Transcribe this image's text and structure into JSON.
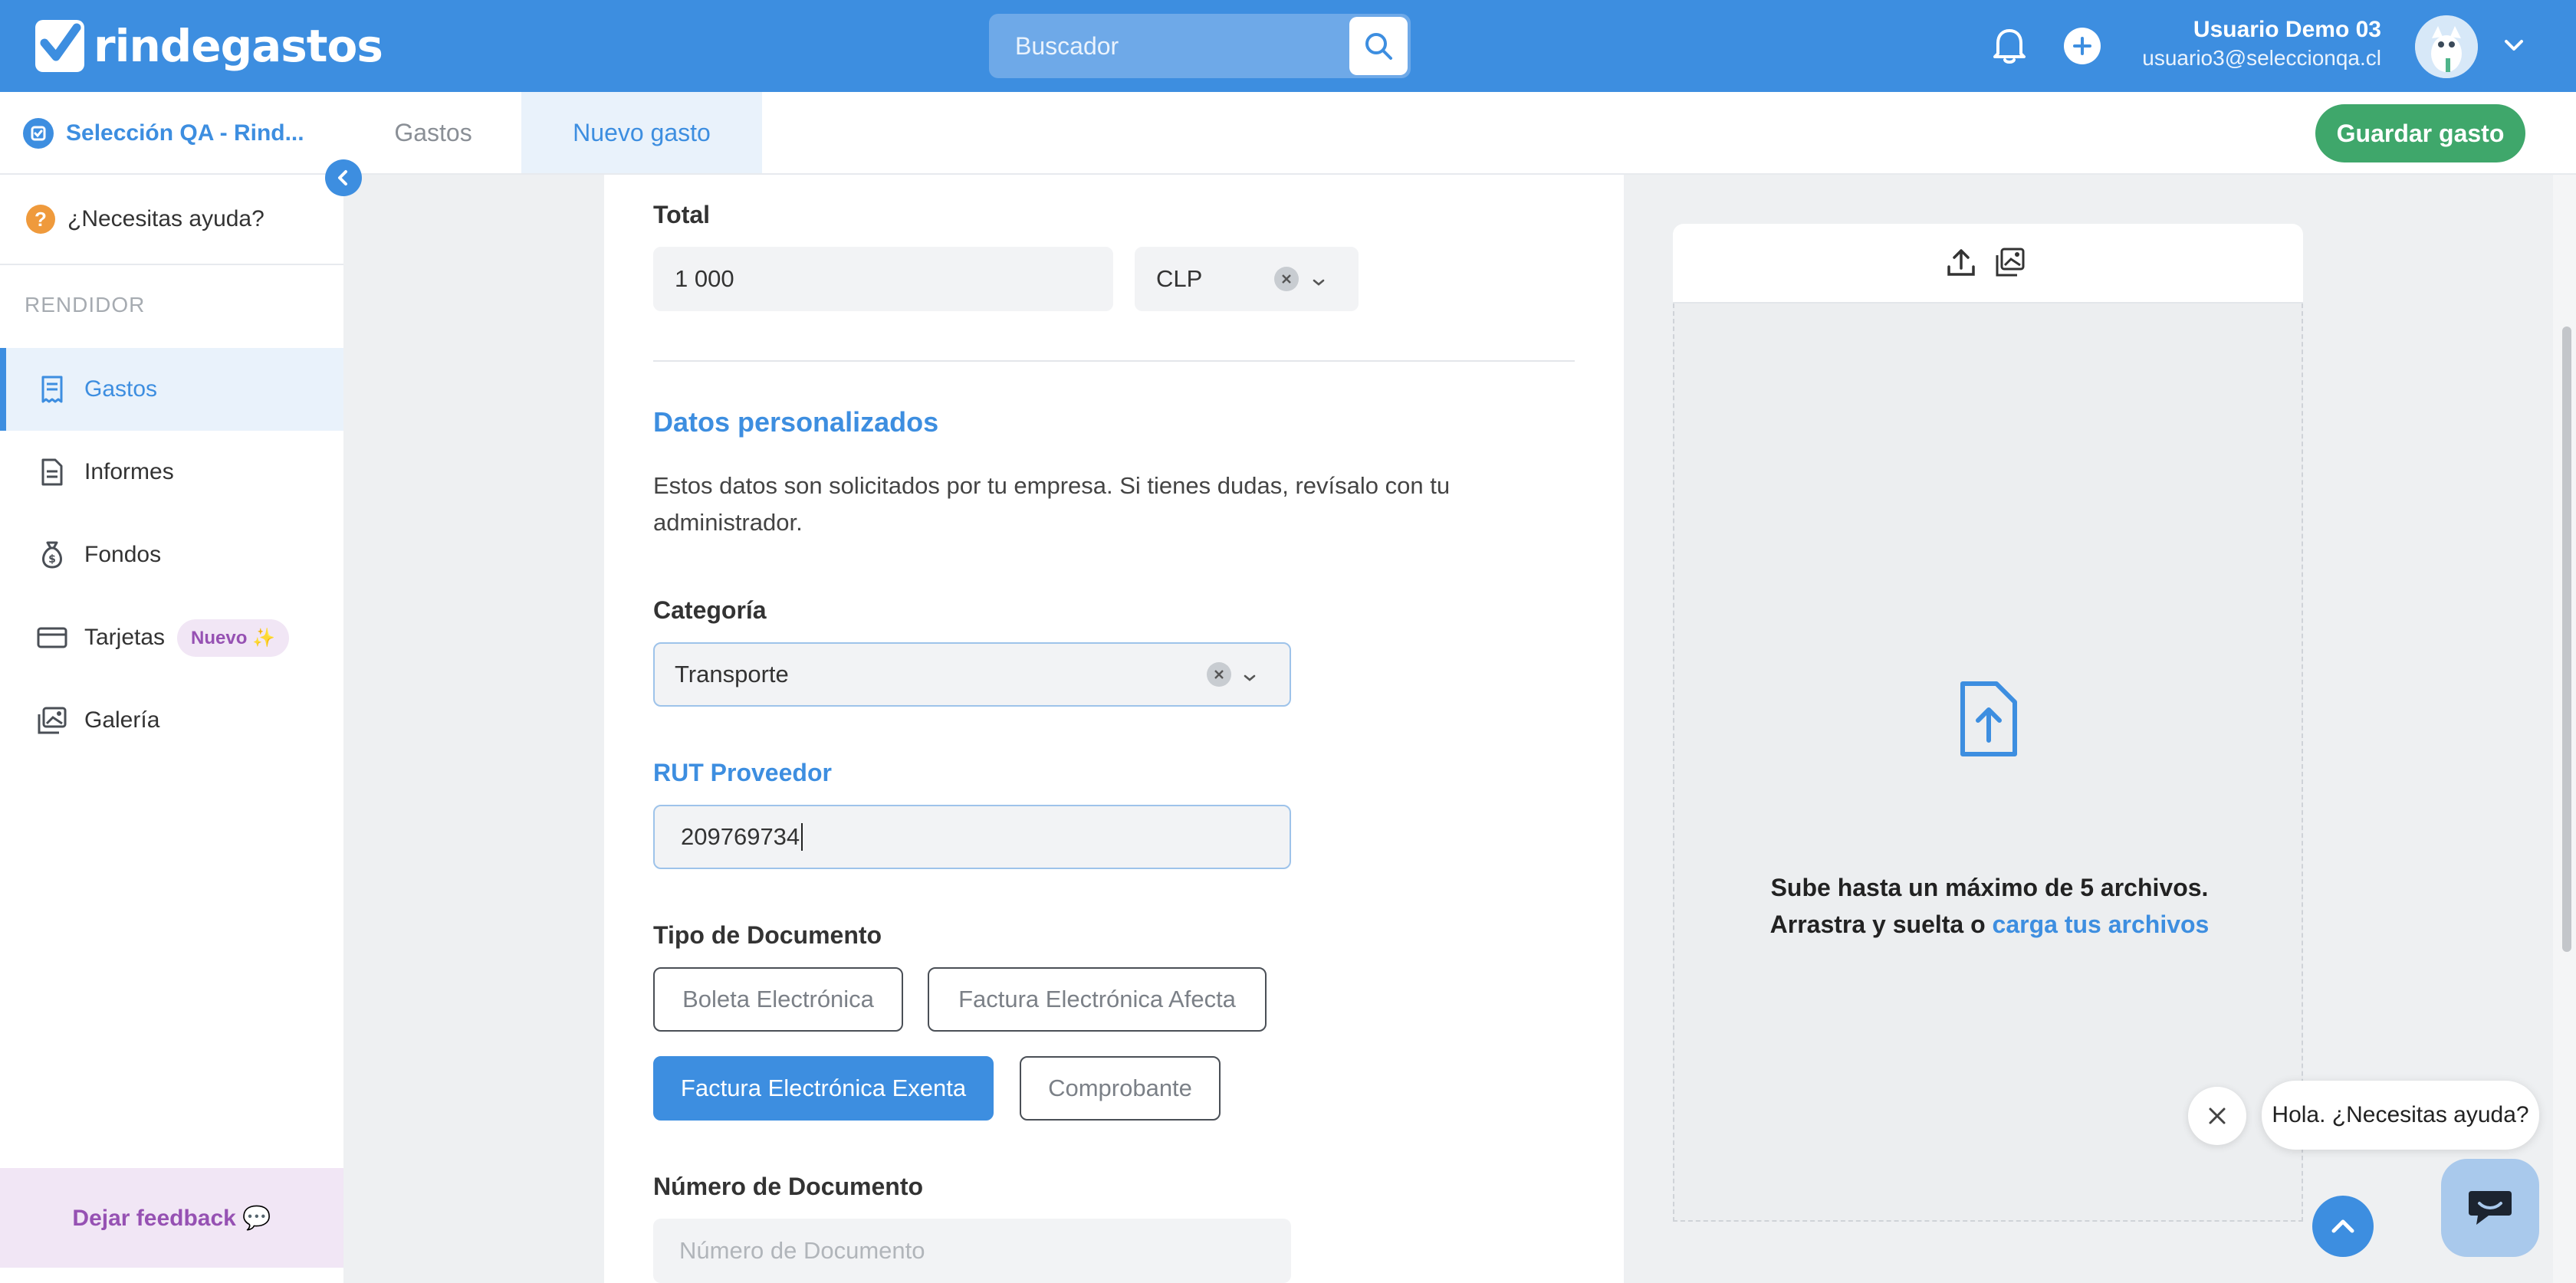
{
  "header": {
    "logo_text": "rindegastos",
    "search_placeholder": "Buscador",
    "user_name": "Usuario Demo 03",
    "user_email": "usuario3@seleccionqa.cl"
  },
  "subheader": {
    "company": "Selección QA - Rind...",
    "tabs": [
      {
        "label": "Gastos"
      },
      {
        "label": "Nuevo gasto"
      }
    ],
    "save_label": "Guardar gasto"
  },
  "sidebar": {
    "help_label": "¿Necesitas ayuda?",
    "section": "RENDIDOR",
    "items": [
      {
        "label": "Gastos",
        "icon": "receipt-icon"
      },
      {
        "label": "Informes",
        "icon": "document-icon"
      },
      {
        "label": "Fondos",
        "icon": "money-bag-icon"
      },
      {
        "label": "Tarjetas",
        "icon": "credit-card-icon",
        "badge": "Nuevo ✨"
      },
      {
        "label": "Galería",
        "icon": "gallery-icon"
      }
    ],
    "feedback_label": "Dejar feedback 💬"
  },
  "form": {
    "total_label": "Total",
    "total_value": "1 000",
    "currency_value": "CLP",
    "section_title": "Datos personalizados",
    "section_help": "Estos datos son solicitados por tu empresa. Si tienes dudas, revísalo con tu administrador.",
    "category_label": "Categoría",
    "category_value": "Transporte",
    "rut_label": "RUT Proveedor",
    "rut_value": "209769734",
    "doc_type_label": "Tipo de Documento",
    "doc_types": [
      {
        "label": "Boleta Electrónica",
        "selected": false
      },
      {
        "label": "Factura Electrónica Afecta",
        "selected": false
      },
      {
        "label": "Factura Electrónica Exenta",
        "selected": true
      },
      {
        "label": "Comprobante",
        "selected": false
      }
    ],
    "doc_number_label": "Número de Documento",
    "doc_number_placeholder": "Número de Documento"
  },
  "upload": {
    "line1": "Sube hasta un máximo de 5 archivos.",
    "line2_prefix": "Arrastra y suelta o ",
    "line2_link": "carga tus archivos"
  },
  "chat": {
    "bubble_text": "Hola. ¿Necesitas ayuda?"
  },
  "colors": {
    "brand_blue": "#3d8ee0",
    "save_green": "#3fa76b",
    "feedback_purple": "#9651b3",
    "help_orange": "#ef9a3c"
  }
}
